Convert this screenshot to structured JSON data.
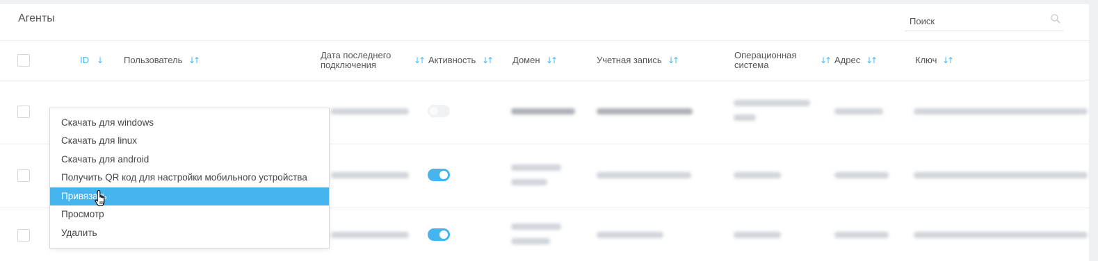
{
  "page": {
    "title": "Агенты"
  },
  "search": {
    "placeholder": "Поиск"
  },
  "table": {
    "columns": [
      {
        "key": "id",
        "label": "ID",
        "sort": "↓"
      },
      {
        "key": "user",
        "label": "Пользователь",
        "sort": "↓↑"
      },
      {
        "key": "last_conn",
        "label_line1": "Дата последнего",
        "label_line2": "подключения",
        "sort": "↓↑"
      },
      {
        "key": "activity",
        "label": "Активность",
        "sort": "↓↑"
      },
      {
        "key": "domain",
        "label": "Домен",
        "sort": "↓↑"
      },
      {
        "key": "account",
        "label": "Учетная запись",
        "sort": "↓↑"
      },
      {
        "key": "os",
        "label_line1": "Операционная",
        "label_line2": "система",
        "sort": "↓↑"
      },
      {
        "key": "address",
        "label": "Адрес",
        "sort": "↓↑"
      },
      {
        "key": "key",
        "label": "Ключ",
        "sort": "↓↑"
      }
    ],
    "rows": [
      {
        "active": false
      },
      {
        "active": true
      },
      {
        "active": true
      }
    ]
  },
  "context_menu": {
    "items": [
      "Скачать для windows",
      "Скачать для linux",
      "Скачать для android",
      "Получить QR код для настройки мобильного устройства",
      "Привязать",
      "Просмотр",
      "Удалить"
    ],
    "active_index": 4
  },
  "colors": {
    "accent": "#46b5ef",
    "border": "#eceff2",
    "text": "#555555"
  },
  "icons": {
    "search": "search-icon",
    "cursor": "hand-pointer-icon"
  }
}
